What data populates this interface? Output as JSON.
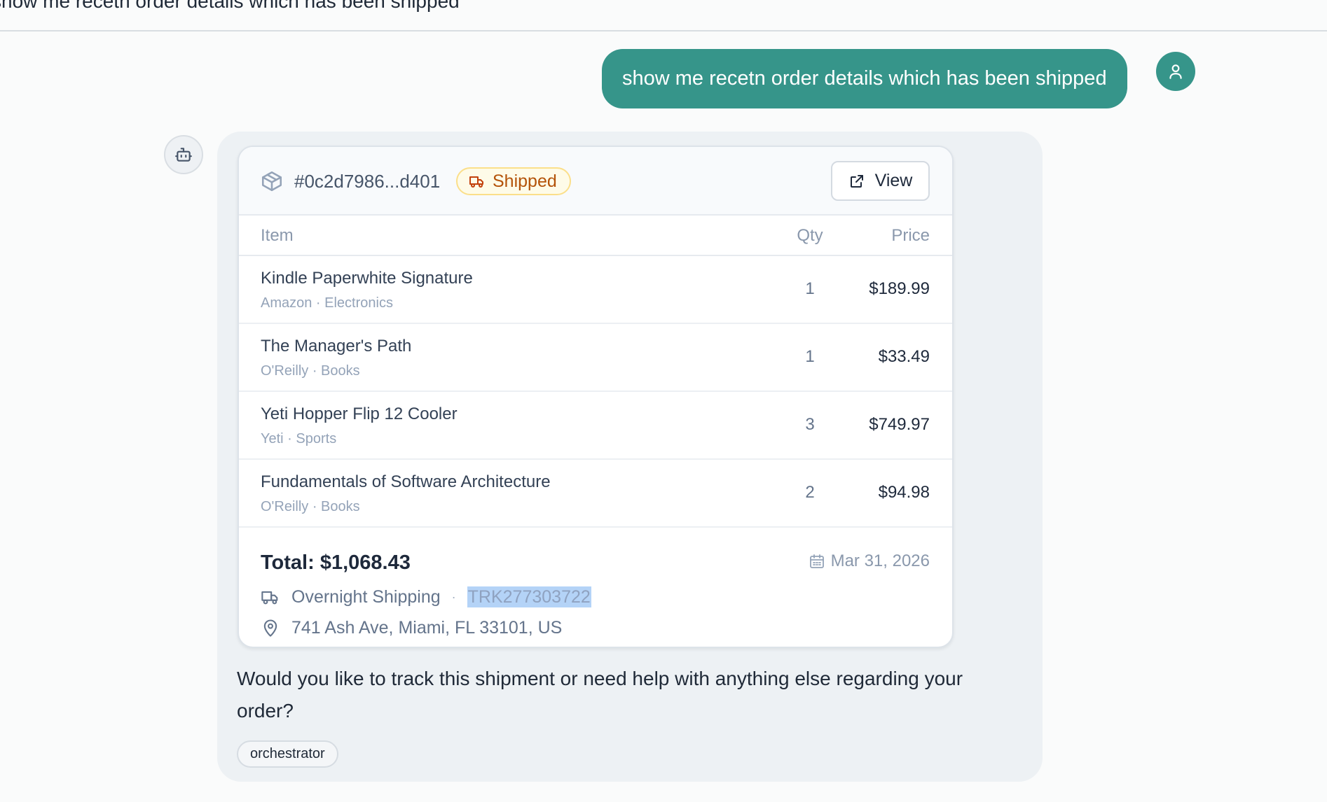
{
  "conversation": {
    "title": "show me recetn order details which has been shipped"
  },
  "user_message": {
    "text": "show me recetn order details which has been shipped",
    "avatar_icon": "user-icon",
    "color": "#36958a"
  },
  "assistant_message": {
    "avatar_icon": "bot-icon",
    "order": {
      "id": "#0c2d7986...d401",
      "status": "Shipped",
      "status_color": "#b45309",
      "view_label": "View",
      "columns": {
        "item": "Item",
        "qty": "Qty",
        "price": "Price"
      },
      "items": [
        {
          "name": "Kindle Paperwhite Signature",
          "meta": "Amazon · Electronics",
          "qty": "1",
          "price": "$189.99"
        },
        {
          "name": "The Manager's Path",
          "meta": "O'Reilly · Books",
          "qty": "1",
          "price": "$33.49"
        },
        {
          "name": "Yeti Hopper Flip 12 Cooler",
          "meta": "Yeti · Sports",
          "qty": "3",
          "price": "$749.97"
        },
        {
          "name": "Fundamentals of Software Architecture",
          "meta": "O'Reilly · Books",
          "qty": "2",
          "price": "$94.98"
        }
      ],
      "total": "Total: $1,068.43",
      "date": "Mar 31, 2026",
      "shipping_method": "Overnight Shipping",
      "separator": "·",
      "tracking_number": "TRK277303722",
      "address": "741 Ash Ave, Miami, FL 33101, US"
    },
    "reply": "Would you like to track this shipment or need help with anything else regarding your order?",
    "agent_tag": "orchestrator"
  }
}
